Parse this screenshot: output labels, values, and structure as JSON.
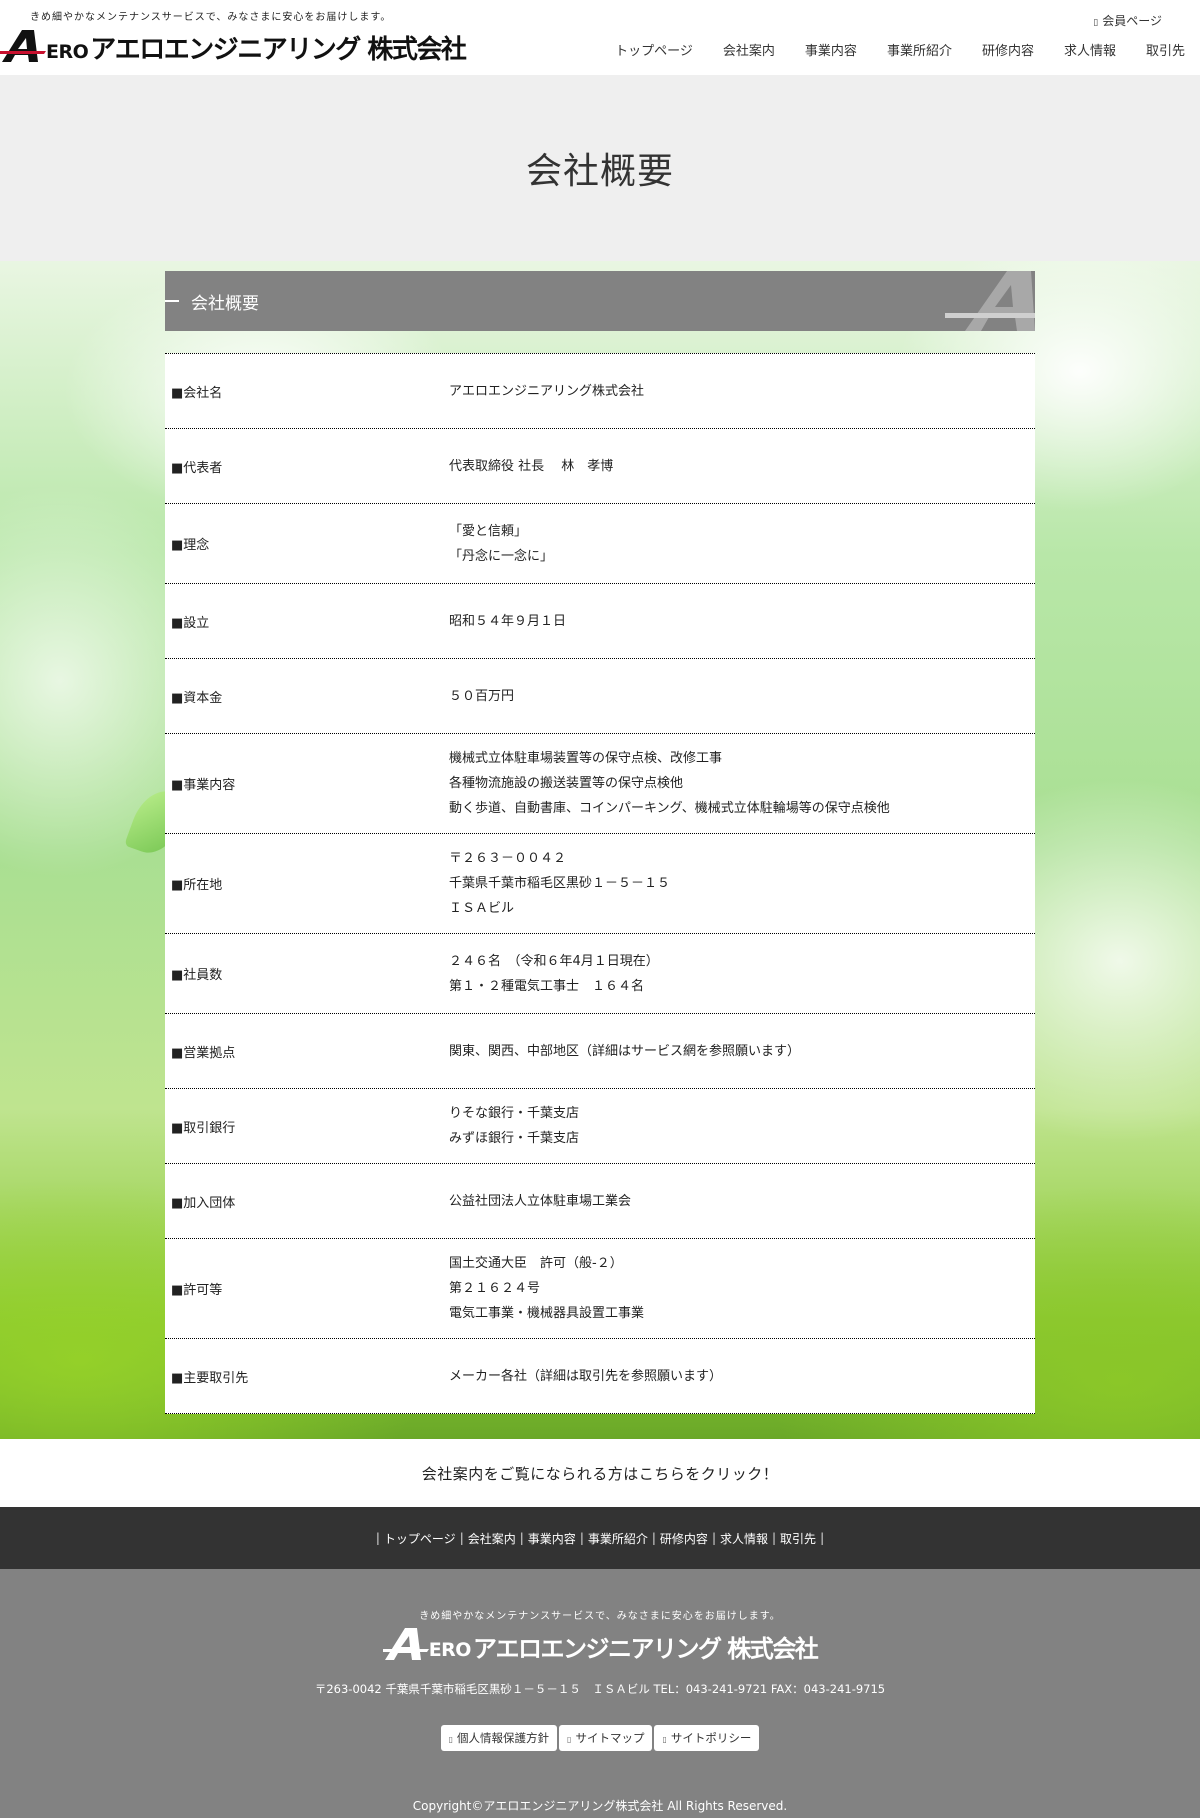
{
  "header": {
    "tagline": "きめ細やかなメンテナンスサービスで、みなさまに安心をお届けします。",
    "logo_ero": "ERO",
    "logo_name": "アエロエンジニアリング 株式会社",
    "member_icon": "lock-icon",
    "member_label": "会員ページ"
  },
  "nav": {
    "items": [
      "トップページ",
      "会社案内",
      "事業内容",
      "事業所紹介",
      "研修内容",
      "求人情報",
      "取引先"
    ]
  },
  "page": {
    "title": "会社概要"
  },
  "panel": {
    "title": "会社概要"
  },
  "table": {
    "rows": [
      {
        "label": "■会社名",
        "lines": [
          "アエロエンジニアリング株式会社"
        ]
      },
      {
        "label": "■代表者",
        "lines": [
          "代表取締役 社長　 林　孝博"
        ]
      },
      {
        "label": "■理念",
        "lines": [
          "「愛と信頼」",
          "「丹念に一念に」"
        ]
      },
      {
        "label": "■設立",
        "lines": [
          "昭和５４年９月１日"
        ]
      },
      {
        "label": "■資本金",
        "lines": [
          "５０百万円"
        ]
      },
      {
        "label": "■事業内容",
        "lines": [
          "機械式立体駐車場装置等の保守点検、改修工事",
          "各種物流施設の搬送装置等の保守点検他",
          "動く歩道、自動書庫、コインパーキング、機械式立体駐輪場等の保守点検他"
        ]
      },
      {
        "label": "■所在地",
        "lines": [
          "〒２６３－００４２",
          "千葉県千葉市稲毛区黒砂１－５－１５",
          "ＩＳＡビル"
        ]
      },
      {
        "label": "■社員数",
        "lines": [
          "２４６名　（令和６年4月１日現在）",
          "第１・２種電気工事士　１６４名"
        ]
      },
      {
        "label": "■営業拠点",
        "lines": [
          "関東、関西、中部地区（詳細はサービス網を参照願います）"
        ]
      },
      {
        "label": "■取引銀行",
        "lines": [
          "りそな銀行・千葉支店",
          "みずほ銀行・千葉支店"
        ]
      },
      {
        "label": "■加入団体",
        "lines": [
          "公益社団法人立体駐車場工業会"
        ]
      },
      {
        "label": "■許可等",
        "lines": [
          "国土交通大臣　許可（般-２）",
          "第２１６２４号",
          "電気工事業・機械器具設置工事業"
        ]
      },
      {
        "label": "■主要取引先",
        "lines": [
          "メーカー各社（詳細は取引先を参照願います）"
        ]
      }
    ]
  },
  "brochure_link": "会社案内をご覧になられる方はこちらをクリック！",
  "footer_nav": {
    "separator": "|",
    "items": [
      "トップページ",
      "会社案内",
      "事業内容",
      "事業所紹介",
      "研修内容",
      "求人情報",
      "取引先"
    ]
  },
  "footer": {
    "tagline": "きめ細やかなメンテナンスサービスで、みなさまに安心をお届けします。",
    "logo_ero": "ERO",
    "logo_name": "アエロエンジニアリング 株式会社",
    "address": "〒263-0042 千葉県千葉市稲毛区黒砂１－５－１５　ＩＳＡビル TEL：043-241-9721 FAX：043-241-9715",
    "link_icon": "arrow-icon",
    "links": [
      "個人情報保護方針",
      "サイトマップ",
      "サイトポリシー"
    ],
    "copyright": "Copyright©アエロエンジニアリング株式会社 All Rights Reserved."
  },
  "colors": {
    "panel_header": "#828282",
    "footer_nav_bg": "#333333",
    "footer_bg": "#828282",
    "title_band": "#efefef"
  }
}
